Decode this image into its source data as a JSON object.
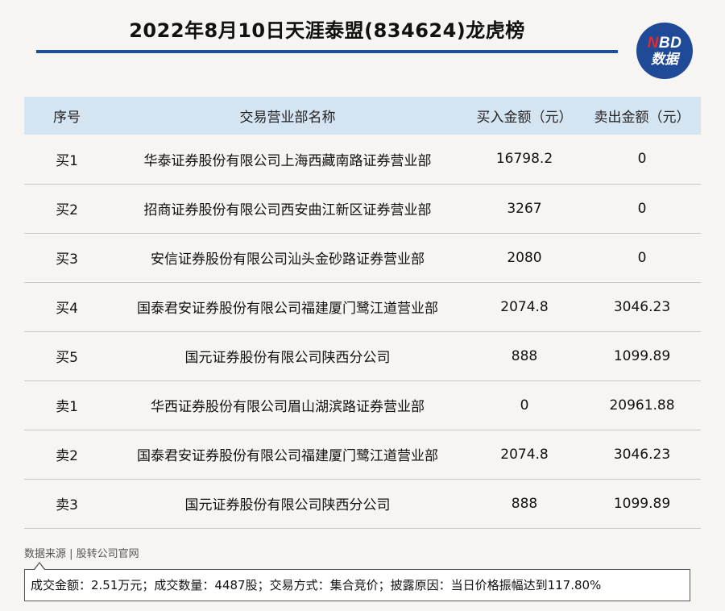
{
  "title": "2022年8月10日天涯泰盟(834624)龙虎榜",
  "logo": {
    "n": "N",
    "bd": "BD",
    "sub": "数据"
  },
  "table": {
    "headers": [
      "序号",
      "交易营业部名称",
      "买入金额（元）",
      "卖出金额（元）"
    ],
    "rows": [
      [
        "买1",
        "华泰证券股份有限公司上海西藏南路证券营业部",
        "16798.2",
        "0"
      ],
      [
        "买2",
        "招商证券股份有限公司西安曲江新区证券营业部",
        "3267",
        "0"
      ],
      [
        "买3",
        "安信证券股份有限公司汕头金砂路证券营业部",
        "2080",
        "0"
      ],
      [
        "买4",
        "国泰君安证券股份有限公司福建厦门鹭江道营业部",
        "2074.8",
        "3046.23"
      ],
      [
        "买5",
        "国元证券股份有限公司陕西分公司",
        "888",
        "1099.89"
      ],
      [
        "卖1",
        "华西证券股份有限公司眉山湖滨路证券营业部",
        "0",
        "20961.88"
      ],
      [
        "卖2",
        "国泰君安证券股份有限公司福建厦门鹭江道营业部",
        "2074.8",
        "3046.23"
      ],
      [
        "卖3",
        "国元证券股份有限公司陕西分公司",
        "888",
        "1099.89"
      ]
    ]
  },
  "source": "数据来源 | 股转公司官网",
  "summary": "成交金额：2.51万元；成交数量：4487股；交易方式：集合竞价；披露原因：当日价格振幅达到117.80%"
}
